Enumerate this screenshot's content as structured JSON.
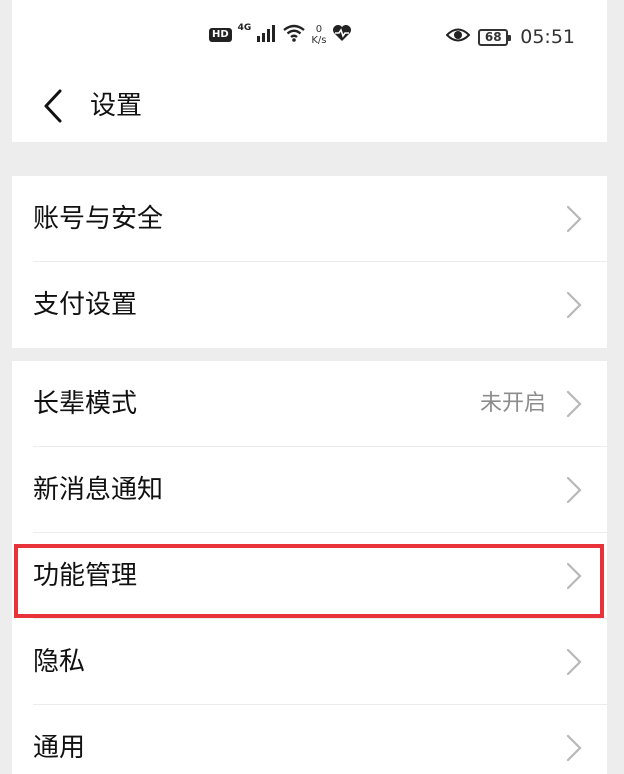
{
  "status_bar": {
    "hd": "HD",
    "network_type": "4G",
    "speed_value": "0",
    "speed_unit": "K/s",
    "battery_level": "68",
    "time": "05:51",
    "icons": [
      "signal-icon",
      "wifi-icon",
      "heart-rate-icon",
      "eye-icon",
      "battery-icon"
    ]
  },
  "navbar": {
    "title": "设置"
  },
  "groups": [
    {
      "items": [
        {
          "label": "账号与安全",
          "value": ""
        },
        {
          "label": "支付设置",
          "value": ""
        }
      ]
    },
    {
      "items": [
        {
          "label": "长辈模式",
          "value": "未开启"
        },
        {
          "label": "新消息通知",
          "value": ""
        },
        {
          "label": "功能管理",
          "value": "",
          "highlighted": true
        },
        {
          "label": "隐私",
          "value": ""
        },
        {
          "label": "通用",
          "value": ""
        }
      ]
    }
  ],
  "colors": {
    "background": "#ededed",
    "surface": "#ffffff",
    "highlight": "#e8333b",
    "secondary_text": "#8c8c8c",
    "chevron": "#b8b8b8"
  }
}
